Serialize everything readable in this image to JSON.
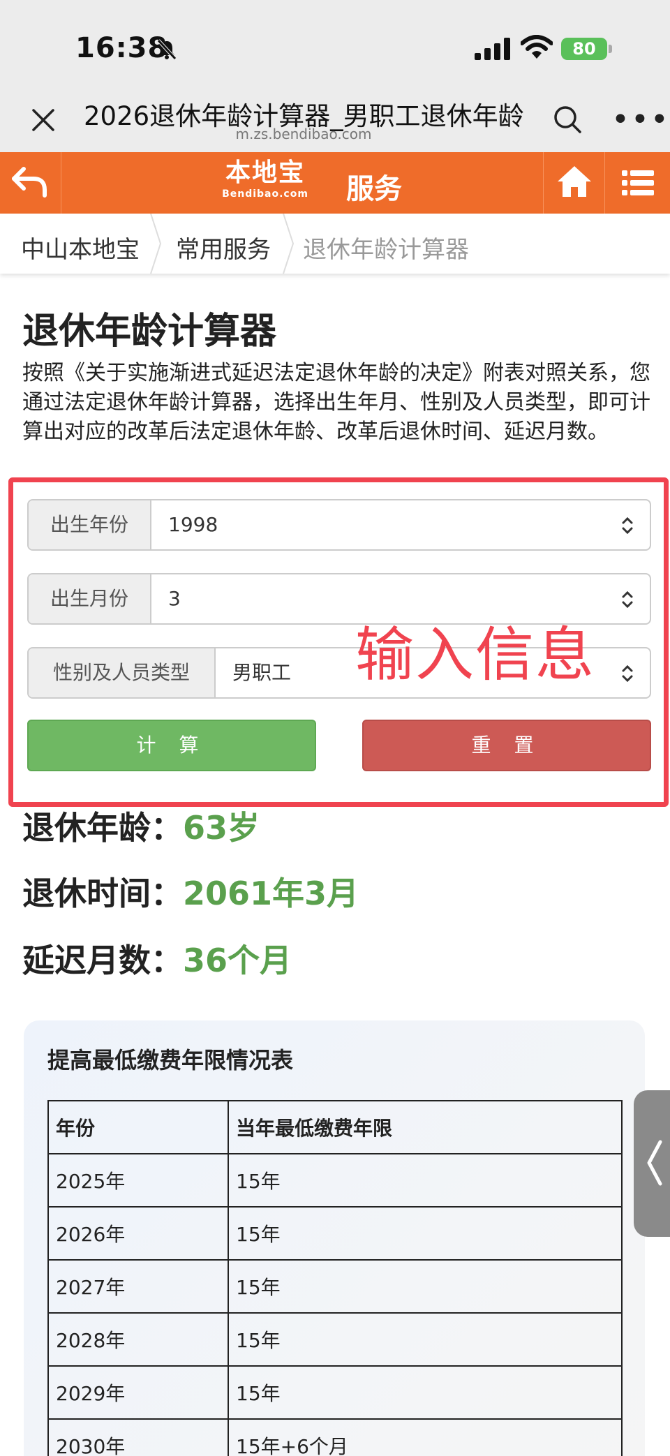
{
  "status_bar": {
    "time": "16:38",
    "battery": "80"
  },
  "browser": {
    "title": "2026退休年龄计算器_男职工退休年龄",
    "url": "m.zs.bendibao.com"
  },
  "header": {
    "logo_main": "本地宝",
    "logo_sub": "Bendibao.com",
    "title": "服务",
    "accent_color": "#ef6c2a"
  },
  "breadcrumb": [
    "中山本地宝",
    "常用服务",
    "退休年龄计算器"
  ],
  "page": {
    "title": "退休年龄计算器",
    "description": "按照《关于实施渐进式延迟法定退休年龄的决定》附表对照关系，您通过法定退休年龄计算器，选择出生年月、性别及人员类型，即可计算出对应的改革后法定退休年龄、改革后退休时间、延迟月数。"
  },
  "form": {
    "birth_year_label": "出生年份",
    "birth_year_value": "1998",
    "birth_month_label": "出生月份",
    "birth_month_value": "3",
    "type_label": "性别及人员类型",
    "type_value": "男职工",
    "calc_label": "计 算",
    "reset_label": "重 置",
    "annotation": "输入信息"
  },
  "results": {
    "age_label": "退休年龄：",
    "age_value": "63岁",
    "time_label": "退休时间：",
    "time_value": "2061年3月",
    "delay_label": "延迟月数：",
    "delay_value": "36个月"
  },
  "fee_table": {
    "title": "提高最低缴费年限情况表",
    "headers": [
      "年份",
      "当年最低缴费年限"
    ],
    "rows": [
      [
        "2025年",
        "15年"
      ],
      [
        "2026年",
        "15年"
      ],
      [
        "2027年",
        "15年"
      ],
      [
        "2028年",
        "15年"
      ],
      [
        "2029年",
        "15年"
      ],
      [
        "2030年",
        "15年+6个月"
      ]
    ]
  }
}
